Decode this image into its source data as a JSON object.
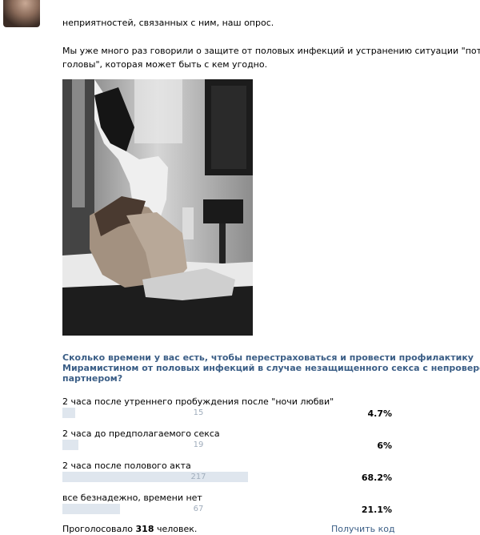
{
  "post": {
    "intro_cut": "неприятностей, связанных с ним, наш опрос.",
    "paragraph_lines": [
      "Мы уже много раз говорили о защите от половых инфекций и устранению ситуации \"потери",
      "головы\", которая может быть с кем угодно."
    ],
    "photo_icon": "photo-bw"
  },
  "poll": {
    "question_lines": [
      "Сколько времени у вас есть, чтобы перестраховаться и провести профилактику",
      "Мирамистином от половых инфекций в случае незащищенного секса с непроверенным",
      "партнером?"
    ],
    "options": [
      {
        "label": "2 часа после утреннего пробуждения после \"ночи любви\"",
        "count": "15",
        "percent": "4.7%",
        "fraction": 0.047
      },
      {
        "label": "2 часа до предполагаемого секса",
        "count": "19",
        "percent": "6%",
        "fraction": 0.06
      },
      {
        "label": "2 часа после полового акта",
        "count": "217",
        "percent": "68.2%",
        "fraction": 0.682
      },
      {
        "label": "все безнадежно, времени нет",
        "count": "67",
        "percent": "21.1%",
        "fraction": 0.211
      }
    ],
    "voted_prefix": "Проголосовало",
    "voted_count": "318",
    "voted_suffix": "человек.",
    "get_code": "Получить код"
  },
  "colors": {
    "link": "#3b5e86",
    "bar": "#dfe6ee",
    "bar_text": "#a0adbc"
  }
}
